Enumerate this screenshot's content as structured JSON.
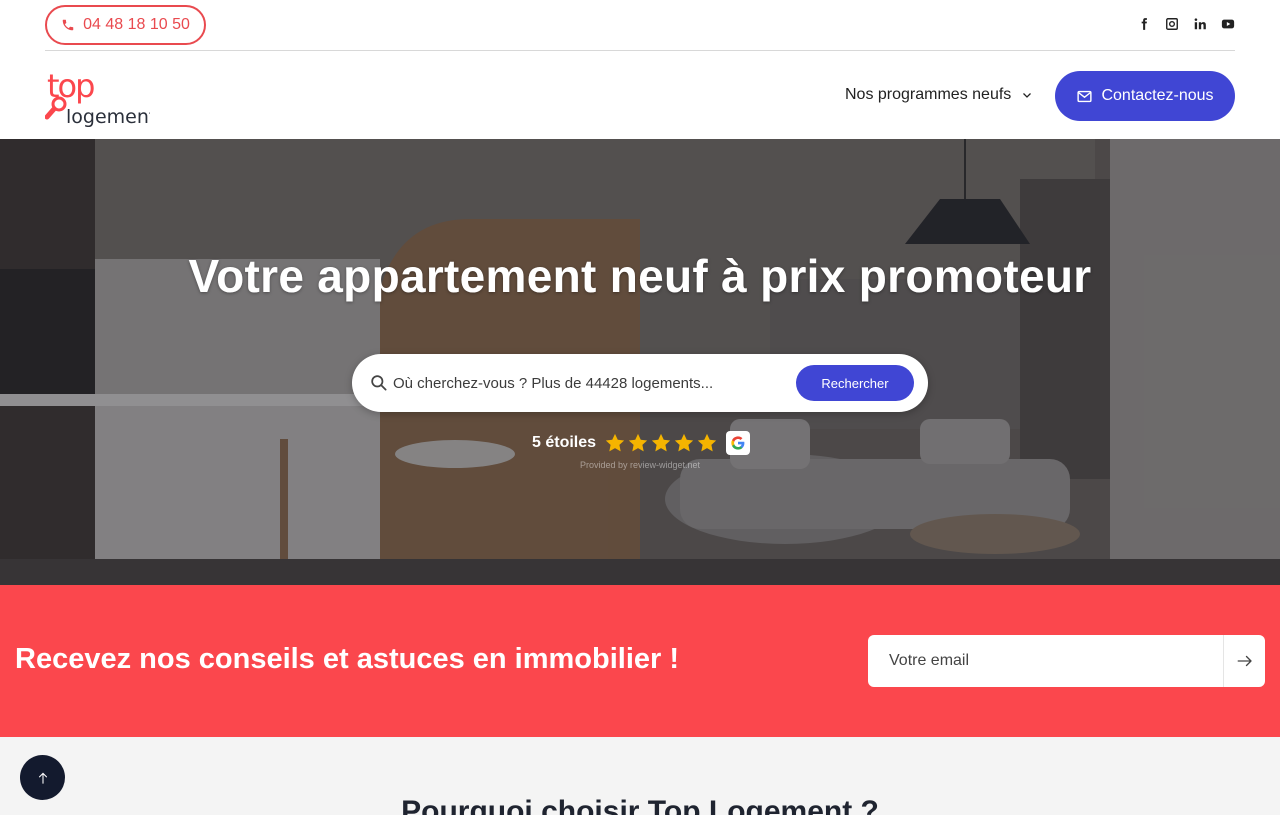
{
  "topbar": {
    "phone": "04 48 18 10 50",
    "socials": [
      "facebook-icon",
      "instagram-icon",
      "linkedin-icon",
      "youtube-icon"
    ]
  },
  "header": {
    "logo_top": "top",
    "logo_bottom": "logement",
    "nav_programmes": "Nos programmes neufs",
    "contact_label": "Contactez-nous"
  },
  "hero": {
    "title": "Votre appartement neuf à prix promoteur",
    "search_placeholder": "Où cherchez-vous ? Plus de 44428 logements...",
    "search_button": "Rechercher",
    "rating_text": "5 étoiles",
    "rating_value": 5,
    "provided_by": "Provided by review-widget.net"
  },
  "newsletter": {
    "title": "Recevez nos conseils et astuces en immobilier !",
    "email_placeholder": "Votre email"
  },
  "section": {
    "why_title": "Pourquoi choisir Top Logement ?"
  },
  "colors": {
    "brand_red": "#fb474d",
    "accent_blue": "#4046d4",
    "dark": "#131a2e"
  }
}
